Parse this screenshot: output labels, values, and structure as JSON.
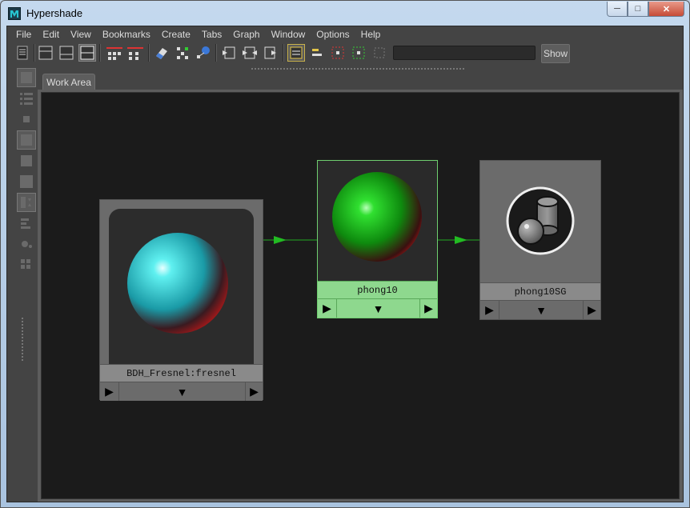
{
  "window": {
    "title": "Hypershade"
  },
  "menu": [
    "File",
    "Edit",
    "View",
    "Bookmarks",
    "Create",
    "Tabs",
    "Graph",
    "Window",
    "Options",
    "Help"
  ],
  "toolbar": {
    "search_value": "",
    "show_label": "Show"
  },
  "tabs": [
    {
      "label": "Work Area"
    }
  ],
  "nodes": [
    {
      "label": "BDH_Fresnel:fresnel",
      "kind": "fresnel",
      "selected": false
    },
    {
      "label": "phong10",
      "kind": "phong",
      "selected": true
    },
    {
      "label": "phong10SG",
      "kind": "shading-group",
      "selected": false
    }
  ],
  "colors": {
    "ui_bg": "#444444",
    "workspace_bg": "#1b1b1b",
    "node_bg": "#6b6b6b",
    "selected_node": "#8ed88e",
    "connection": "#22aa22"
  },
  "icons": {
    "port_in": "play-right-icon",
    "port_out": "play-right-icon",
    "expand": "triangle-down-icon"
  }
}
